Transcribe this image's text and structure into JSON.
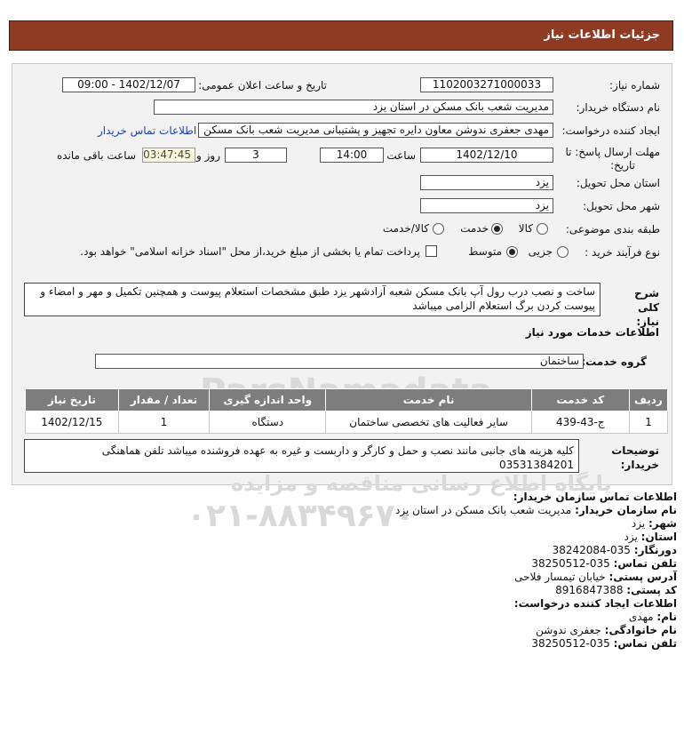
{
  "header": {
    "title": "جزئیات اطلاعات نیاز"
  },
  "fields": {
    "need_number_label": "شماره نیاز:",
    "need_number": "1102003271000033",
    "announce_label": "تاریخ و ساعت اعلان عمومی:",
    "announce_value": "1402/12/07 - 09:00",
    "buyer_org_label": "نام دستگاه خریدار:",
    "buyer_org": "مدیریت شعب بانک مسکن در استان یزد",
    "creator_label": "ایجاد کننده درخواست:",
    "creator": "مهدی  جعفری ندوشن معاون دایره تجهیز و پشتیبانی مدیریت شعب بانک مسکن",
    "contact_link": "اطلاعات تماس خریدار",
    "deadline_label_1": "مهلت ارسال پاسخ: تا",
    "deadline_label_2": "تاریخ:",
    "deadline_date": "1402/12/10",
    "time_label": "ساعت",
    "deadline_time": "14:00",
    "days_value": "3",
    "days_label": "روز و",
    "remaining_time": "03:47:45",
    "remaining_label": "ساعت باقی مانده",
    "province_label": "استان محل تحویل:",
    "province": "یزد",
    "city_label": "شهر محل تحویل:",
    "city": "یزد",
    "category_label": "طبقه بندی موضوعی:",
    "category_options": [
      "کالا",
      "خدمت",
      "کالا/خدمت"
    ],
    "category_selected": "خدمت",
    "process_label": "نوع فرآیند خرید :",
    "process_options": [
      "جزیی",
      "متوسط"
    ],
    "process_selected": "متوسط",
    "treasury_note": "پرداخت تمام یا بخشی از مبلغ خرید،از محل \"اسناد خزانه اسلامی\" خواهد بود."
  },
  "summary": {
    "label": "شرح کلی نیاز:",
    "text": "ساخت و نصب درب رول آپ بانک مسکن شعبه آزادشهر یزد طبق مشخصات استعلام پیوست و همچنین تکمیل و مهر و امضاء و پیوست کردن برگ استعلام الزامی میباشد"
  },
  "services": {
    "section_title": "اطلاعات خدمات مورد نیاز",
    "group_label": "گروه خدمت:",
    "group_value": "ساختمان",
    "columns": [
      "ردیف",
      "کد خدمت",
      "نام خدمت",
      "واحد اندازه گیری",
      "تعداد / مقدار",
      "تاریخ نیاز"
    ],
    "rows": [
      [
        "1",
        "ج-43-439",
        "سایر فعالیت های تخصصی ساختمان",
        "دستگاه",
        "1",
        "1402/12/15"
      ]
    ]
  },
  "buyer_notes": {
    "label_1": "توضیحات",
    "label_2": "خریدار:",
    "text_1": "کلیه هزینه های جانبی مانند نصب و حمل و کارگر و داربست و غیره به عهده فروشنده میباشد تلفن هماهنگی",
    "text_2": "03531384201"
  },
  "contact": {
    "org_title": "اطلاعات تماس سازمان خریدار:",
    "org_name_label": "نام سازمان خریدار:",
    "org_name": "مدیریت شعب بانک مسکن در استان یزد",
    "city_label": "شهر:",
    "city": "یزد",
    "province_label": "استان:",
    "province": "یزد",
    "fax_label": "دورنگار:",
    "fax": "035-38242084",
    "phone_label": "تلفن تماس:",
    "phone": "035-38250512",
    "address_label": "آدرس پستی:",
    "address": "خیابان تیمسار فلاحی",
    "postal_label": "کد پستی:",
    "postal": "8916847388",
    "creator_title": "اطلاعات ایجاد کننده درخواست:",
    "first_name_label": "نام:",
    "first_name": "مهدی",
    "last_name_label": "نام خانوادگی:",
    "last_name": "جعفری ندوشن",
    "creator_phone_label": "تلفن تماس:",
    "creator_phone": "035-38250512"
  },
  "watermark": {
    "brand": "ParsNamadata",
    "tagline": "پایگاه اطلاع رسانی مناقصه و مزایده",
    "phone": "۰۲۱-۸۸۳۴۹۶۷۰"
  }
}
